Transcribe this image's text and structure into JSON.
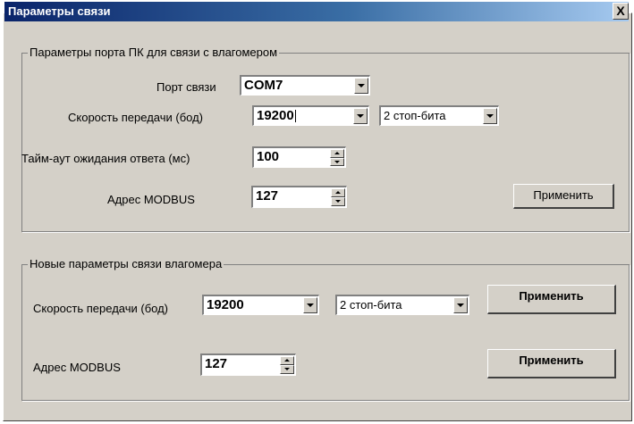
{
  "window": {
    "title": "Параметры связи",
    "close_symbol": "X"
  },
  "pc_port_group": {
    "legend": "Параметры порта ПК для связи с влагомером",
    "port_label": "Порт связи",
    "port_value": "COM7",
    "speed_label": "Скорость передачи (бод)",
    "speed_value": "19200",
    "stopbits_value": "2 стоп-бита",
    "timeout_label": "Тайм-аут ожидания ответа (мс)",
    "timeout_value": "100",
    "address_label": "Адрес MODBUS",
    "address_value": "127",
    "apply_label": "Применить"
  },
  "meter_group": {
    "legend": "Новые параметры связи влагомера",
    "speed_label": "Скорость передачи (бод)",
    "speed_value": "19200",
    "stopbits_value": "2 стоп-бита",
    "apply_speed_label": "Применить",
    "address_label": "Адрес MODBUS",
    "address_value": "127",
    "apply_address_label": "Применить"
  }
}
